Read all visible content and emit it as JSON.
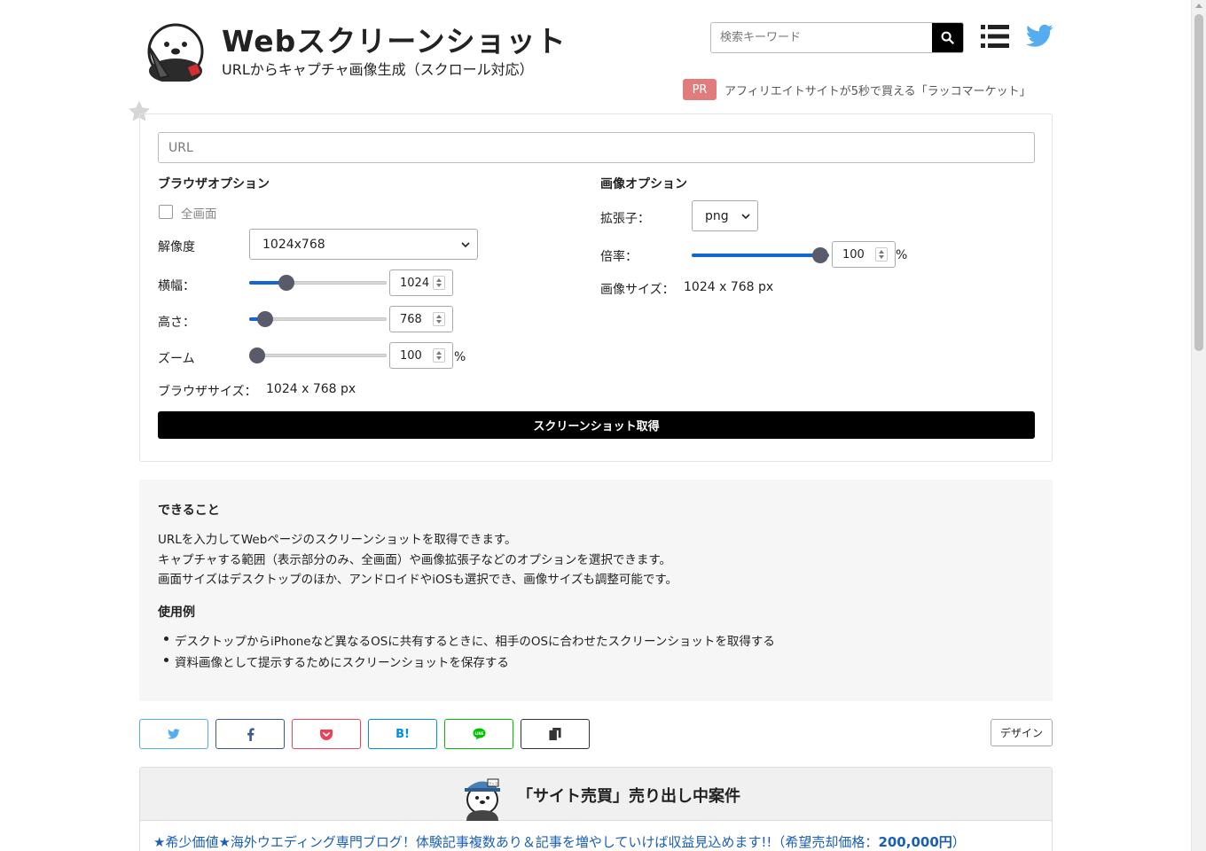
{
  "header": {
    "title": "Webスクリーンショット",
    "subtitle": "URLからキャプチャ画像生成（スクロール対応）",
    "search_placeholder": "検索キーワード",
    "pr_badge": "PR",
    "pr_text": "アフィリエイトサイトが5秒で買える「ラッコマーケット」"
  },
  "form": {
    "url_placeholder": "URL",
    "browser_options": {
      "title": "ブラウザオプション",
      "fullscreen_label": "全画面",
      "fullscreen_checked": false,
      "resolution_label": "解像度",
      "resolution_value": "1024x768",
      "width_label": "横幅：",
      "width_value": "1024",
      "height_label": "高さ：",
      "height_value": "768",
      "zoom_label": "ズーム",
      "zoom_value": "100",
      "zoom_unit": "%",
      "browser_size_label": "ブラウザサイズ：",
      "browser_size_value": "1024 x 768 px"
    },
    "image_options": {
      "title": "画像オプション",
      "ext_label": "拡張子：",
      "ext_value": "png",
      "scale_label": "倍率：",
      "scale_value": "100",
      "scale_unit": "%",
      "image_size_label": "画像サイズ：",
      "image_size_value": "1024 x 768 px"
    },
    "submit_label": "スクリーンショット取得"
  },
  "info": {
    "heading1": "できること",
    "lines": [
      "URLを入力してWebページのスクリーンショットを取得できます。",
      "キャプチャする範囲（表示部分のみ、全画面）や画像拡張子などのオプションを選択できます。",
      "画面サイズはデスクトップのほか、アンドロイドやiOSも選択でき、画像サイズも調整可能です。"
    ],
    "heading2": "使用例",
    "examples": [
      "デスクトップからiPhoneなど異なるOSに共有するときに、相手のOSに合わせたスクリーンショットを取得する",
      "資料画像として提示するためにスクリーンショットを保存する"
    ]
  },
  "share": {
    "hatena_label": "B!",
    "design_label": "デザイン"
  },
  "sale": {
    "title": "「サイト売買」売り出し中案件",
    "mascot_sign": "ラッコ",
    "link_text": "★希少価値★海外ウエディング専門ブログ！体験記事複数あり＆記事を増やしていけば収益見込めます!!（希望売却価格：",
    "link_price": "200,000円",
    "link_close": "）"
  },
  "colors": {
    "accent": "#1565d8",
    "twitter": "#55acee",
    "facebook": "#3b5998",
    "pocket": "#ef4056",
    "hatena": "#008fde",
    "line": "#00c300",
    "pr": "#e07c7c"
  },
  "icons": [
    "search-icon",
    "menu-icon",
    "twitter-icon",
    "star-icon",
    "facebook-icon",
    "pocket-icon",
    "line-icon",
    "copy-icon"
  ]
}
